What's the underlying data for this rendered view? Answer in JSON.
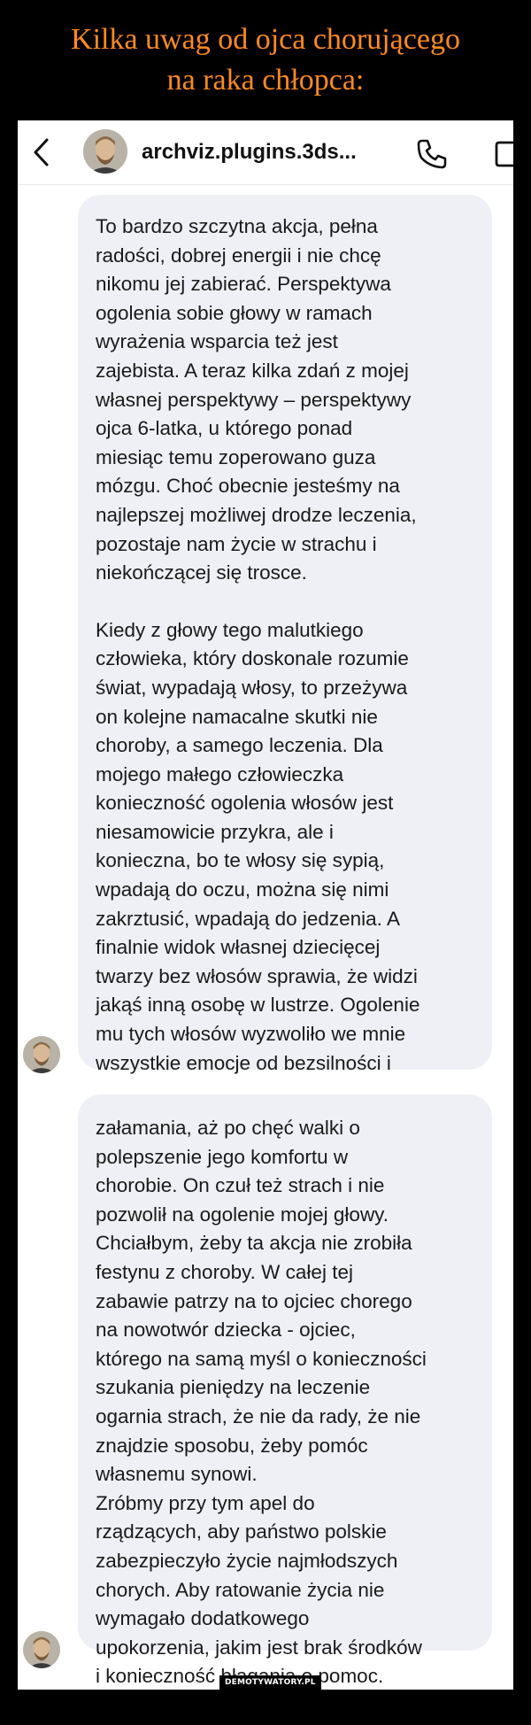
{
  "title": {
    "line1": "Kilka uwag od ojca chorującego",
    "line2": "na raka chłopca:"
  },
  "header": {
    "back_icon": "chevron-left-icon",
    "contact_name": "archviz.plugins.3ds...",
    "call_icon": "phone-icon",
    "video_icon": "video-icon"
  },
  "messages": [
    {
      "paragraphs": [
        "To bardzo szczytna akcja, pełna\nradości, dobrej energii i nie chcę\nnikomu jej zabierać. Perspektywa\nogolenia sobie głowy w ramach\nwyrażenia wsparcia też jest\nzajebista. A teraz kilka zdań z mojej\nwłasnej perspektywy – perspektywy\nojca 6-latka, u którego ponad\nmiesiąc temu zoperowano guza\nmózgu. Choć obecnie jesteśmy na\nnajlepszej możliwej drodze leczenia,\npozostaje nam życie w strachu i\nniekończącej się trosce.",
        "Kiedy z głowy tego malutkiego\nczłowieka, który doskonale rozumie\nświat, wypadają włosy, to przeżywa\non kolejne namacalne skutki nie\nchoroby, a samego leczenia. Dla\nmojego małego człowieczka\nkonieczność ogolenia włosów jest\nniesamowicie przykra, ale i\nkonieczna, bo te włosy się sypią,\nwpadają do oczu, można się nimi\nzakrztusić, wpadają do jedzenia. A\nfinalnie widok własnej dziecięcej\ntwarzy bez włosów sprawia, że widzi\njakąś inną osobę w lustrze. Ogolenie\nmu tych włosów wyzwoliło we mnie\nwszystkie emocje od bezsilności i"
      ]
    },
    {
      "paragraphs": [
        "załamania, aż po chęć walki o\npolepszenie jego komfortu w\nchorobie. On czuł też strach i nie\npozwolił na ogolenie mojej głowy.",
        "Chciałbym, żeby ta akcja nie zrobiła\nfestynu z choroby. W całej tej\nzabawie patrzy na to ojciec chorego\nna nowotwór dziecka - ojciec,\nktórego na samą myśl o konieczności\nszukania pieniędzy na leczenie\nogarnia strach, że nie da rady, że nie\nznajdzie sposobu, żeby pomóc\nwłasnemu synowi.",
        "Zróbmy przy tym apel do\nrządzących, aby państwo polskie\nzabezpieczyło życie najmłodszych\nchorych. Aby ratowanie życia nie\nwymagało dodatkowego\nupokorzenia, jakim jest brak środków\ni konieczność błagania o pomoc."
      ]
    }
  ],
  "watermark": "DEMOTYWATORY.PL",
  "colors": {
    "title": "#ff8a1f",
    "bubble": "#eef0f5",
    "background": "#000000"
  }
}
